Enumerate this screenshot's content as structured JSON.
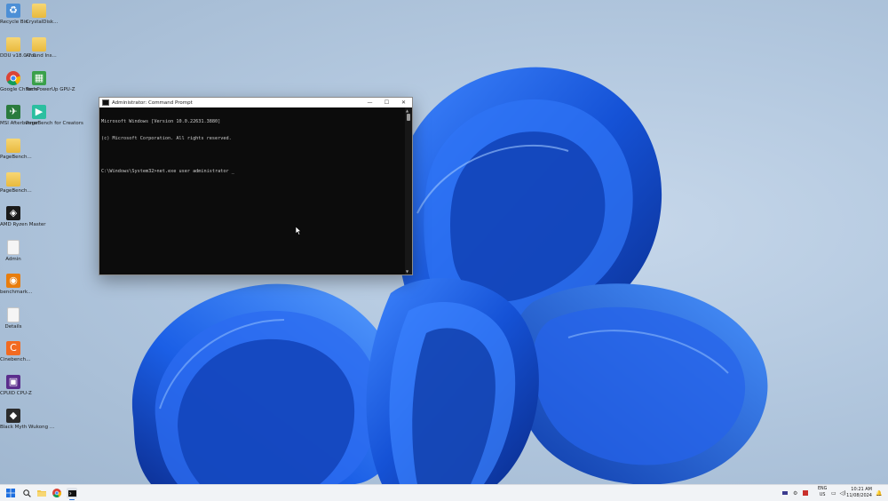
{
  "desktop_icons": [
    {
      "name": "recycle-bin-icon",
      "label": "Recycle Bin",
      "color": "#4c8fd6",
      "glyph": "♻"
    },
    {
      "name": "folder-icon",
      "label": "CrystalDisk...",
      "type": "folder"
    },
    {
      "name": "folder-icon",
      "label": "DDU v18.0.7.0",
      "type": "folder"
    },
    {
      "name": "folder-icon",
      "label": "Around Ins...",
      "type": "folder"
    },
    {
      "name": "chrome-icon",
      "label": "Google Chrome",
      "type": "chrome"
    },
    {
      "name": "gpu-icon",
      "label": "TechPowerUp GPU-Z",
      "color": "#3aa04a",
      "glyph": "▦"
    },
    {
      "name": "msi-afterburner-icon",
      "label": "MSI Afterburner",
      "color": "#2a7b3d",
      "glyph": "✈"
    },
    {
      "name": "pagebench-icon",
      "label": "PageBench for Creators",
      "color": "#2bbfa0",
      "glyph": "▶"
    },
    {
      "name": "folder-icon",
      "label": "PageBench...",
      "type": "folder"
    },
    {
      "name": "folder-icon",
      "label": "PageBench...",
      "type": "folder"
    },
    {
      "name": "amd-ryzen-master-icon",
      "label": "AMD Ryzen Master",
      "color": "#1a1a1a",
      "glyph": "◈"
    },
    {
      "name": "document-icon",
      "label": "Admin",
      "type": "doc"
    },
    {
      "name": "blender-icon",
      "label": "benchmark...",
      "color": "#e87d0d",
      "glyph": "◉"
    },
    {
      "name": "document-icon",
      "label": "Details",
      "type": "doc"
    },
    {
      "name": "cinebench-icon",
      "label": "Cinebench...",
      "color": "#f26a21",
      "glyph": "C"
    },
    {
      "name": "cpuid-icon",
      "label": "CPUID CPU-Z",
      "color": "#5a2d8c",
      "glyph": "▣"
    },
    {
      "name": "black-myth-icon",
      "label": "Black Myth Wukong ...",
      "color": "#2b2b2b",
      "glyph": "◆"
    }
  ],
  "cmd": {
    "title": "Administrator: Command Prompt",
    "minimize": "—",
    "maximize": "☐",
    "close": "✕",
    "lines": [
      "Microsoft Windows [Version 10.0.22631.3880]",
      "(c) Microsoft Corporation. All rights reserved.",
      "",
      "C:\\Windows\\System32>net.exe user administrator _"
    ]
  },
  "taskbar": {
    "language_line1": "ENG",
    "language_line2": "US",
    "time": "10:21 AM",
    "date": "11/08/2024"
  },
  "colors": {
    "accent_blue": "#1e5be0",
    "console_bg": "#0c0c0c",
    "console_text": "#cccccc"
  }
}
